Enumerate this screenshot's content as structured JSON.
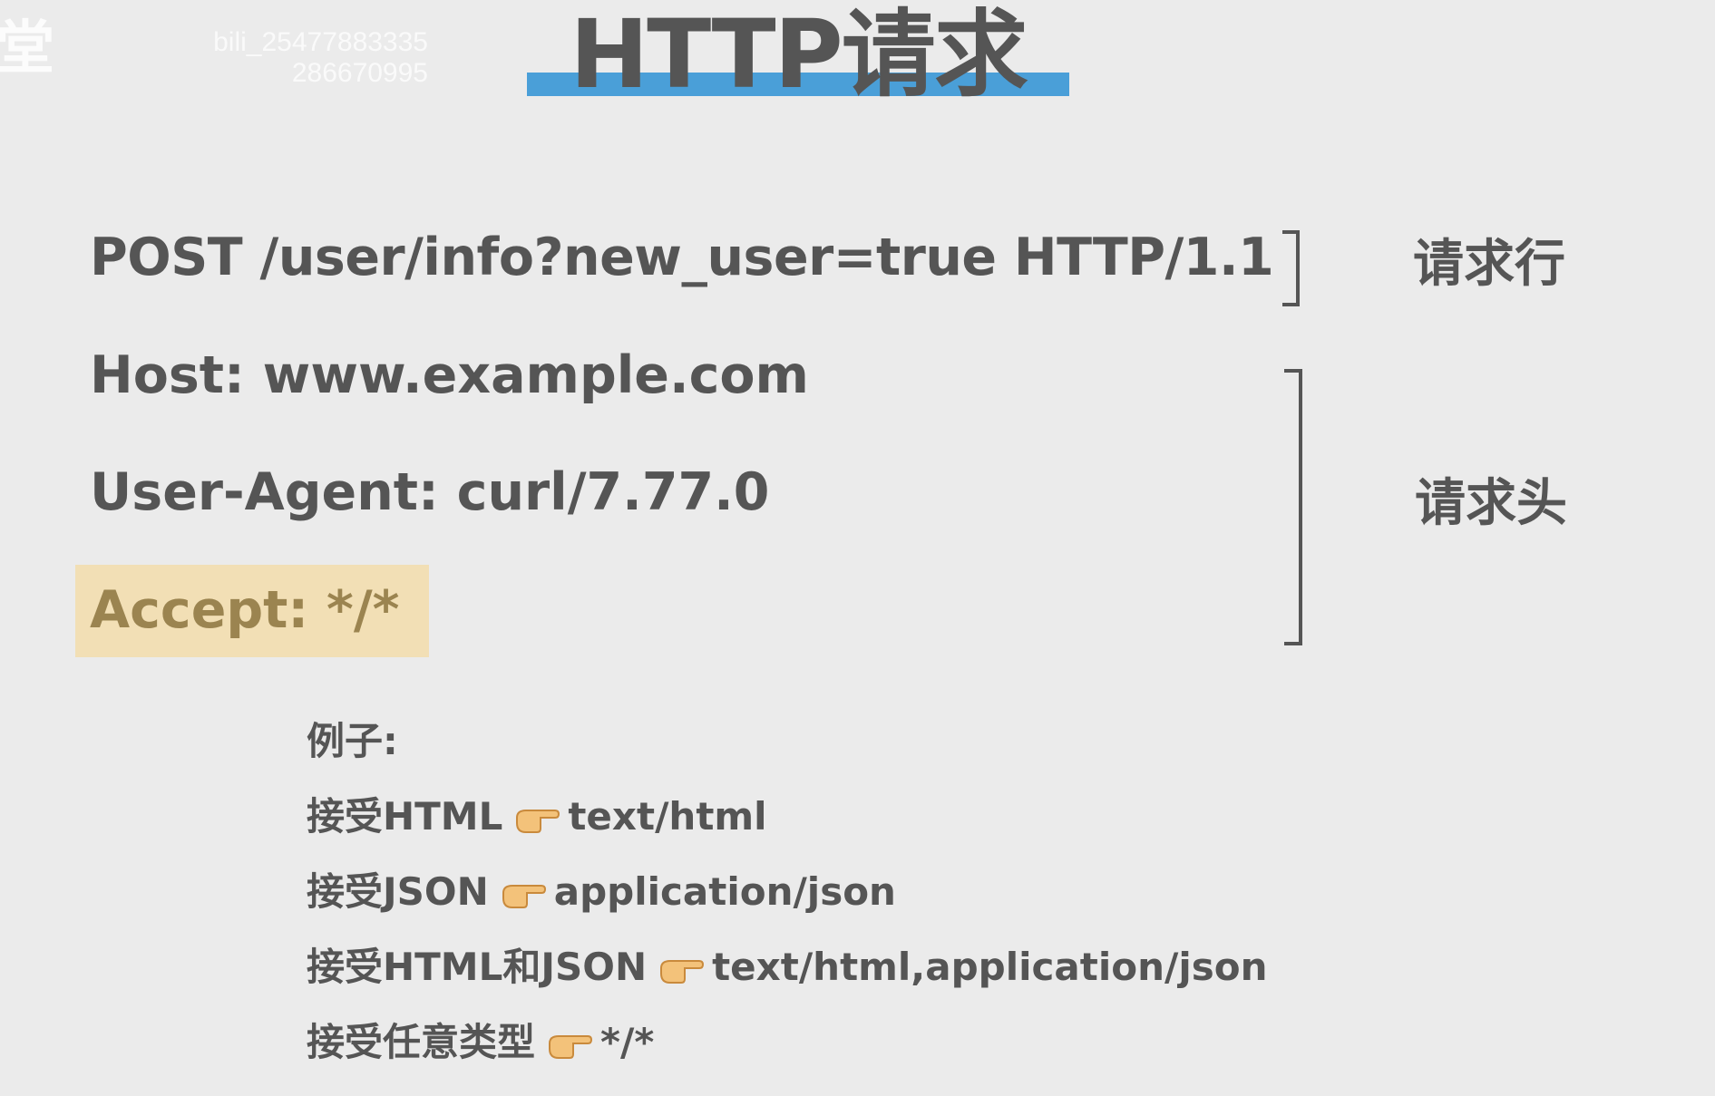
{
  "edge_char": "堂",
  "watermark": {
    "line1": "bili_25477883335",
    "line2": "286670995"
  },
  "title": "HTTP请求",
  "request_line": "POST /user/info?new_user=true HTTP/1.1",
  "headers": {
    "host": "Host: www.example.com",
    "user_agent": "User-Agent: curl/7.77.0",
    "accept": "Accept: */*"
  },
  "labels": {
    "request_line": "请求行",
    "request_header": "请求头"
  },
  "examples": {
    "title": "例子:",
    "items": [
      {
        "label": "接受HTML",
        "value": "text/html"
      },
      {
        "label": "接受JSON",
        "value": "application/json"
      },
      {
        "label": "接受HTML和JSON",
        "value": "text/html,application/json"
      },
      {
        "label": "接受任意类型",
        "value": "*/*"
      }
    ]
  },
  "icons": {
    "pointer": "pointing-hand-icon"
  },
  "colors": {
    "background": "#ebebeb",
    "text": "#555555",
    "title_underline": "#4a9fd8",
    "accept_highlight": "#f2dfb5",
    "accept_text": "#9b8450"
  }
}
